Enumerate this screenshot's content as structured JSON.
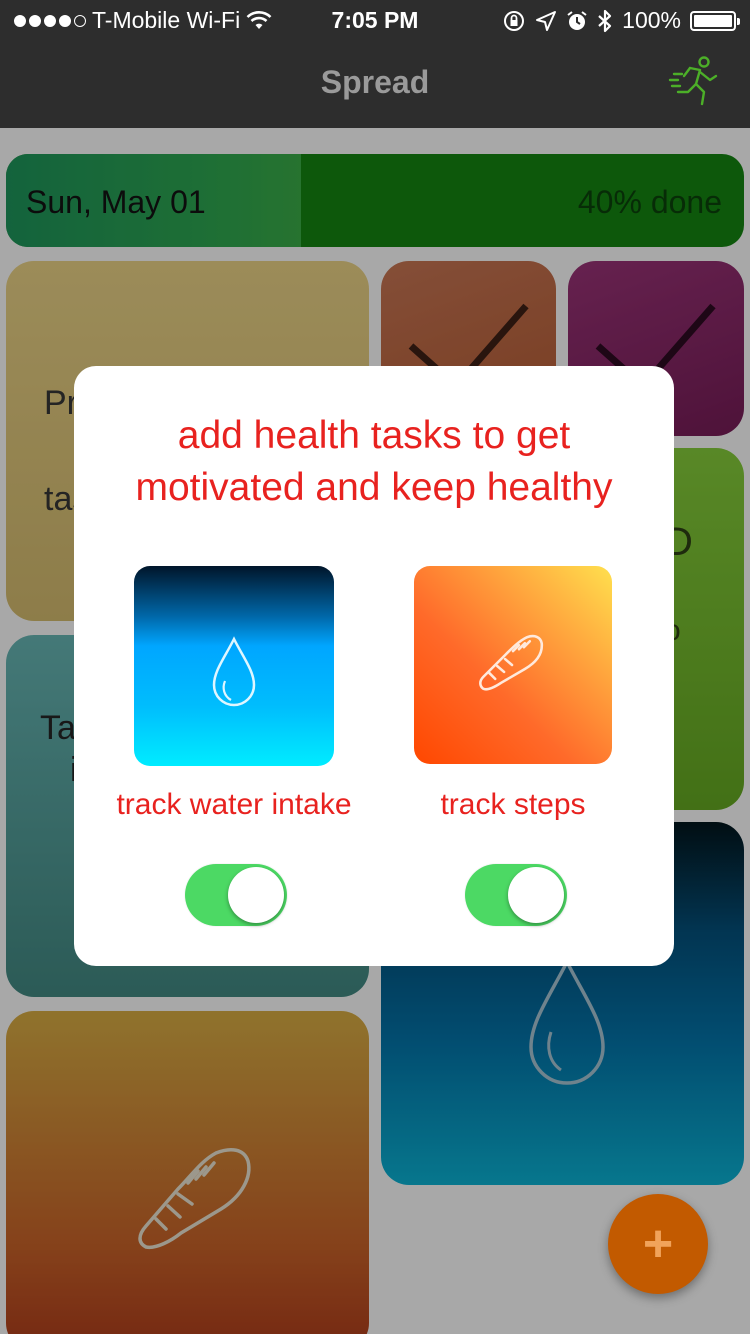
{
  "status_bar": {
    "carrier": "T-Mobile Wi-Fi",
    "time": "7:05 PM",
    "battery": "100%"
  },
  "nav": {
    "title": "Spread",
    "action_icon": "runner-icon",
    "accent_color": "#4caf28"
  },
  "progress": {
    "date": "Sun, May 01",
    "percent_label": "40% done",
    "fraction": 0.4
  },
  "tiles": {
    "yellow_text": [
      "Pr",
      "a",
      "tas"
    ],
    "teal_text": [
      "Ta",
      "i"
    ],
    "green_text": [
      "D",
      "o"
    ]
  },
  "modal": {
    "title_line1": "add health tasks to get",
    "title_line2": "motivated and keep healthy",
    "water_label": "track water intake",
    "steps_label": "track steps",
    "water_enabled": true,
    "steps_enabled": true,
    "accent_color": "#e8221f"
  },
  "fab": {
    "label": "+",
    "color": "#c25a00"
  }
}
